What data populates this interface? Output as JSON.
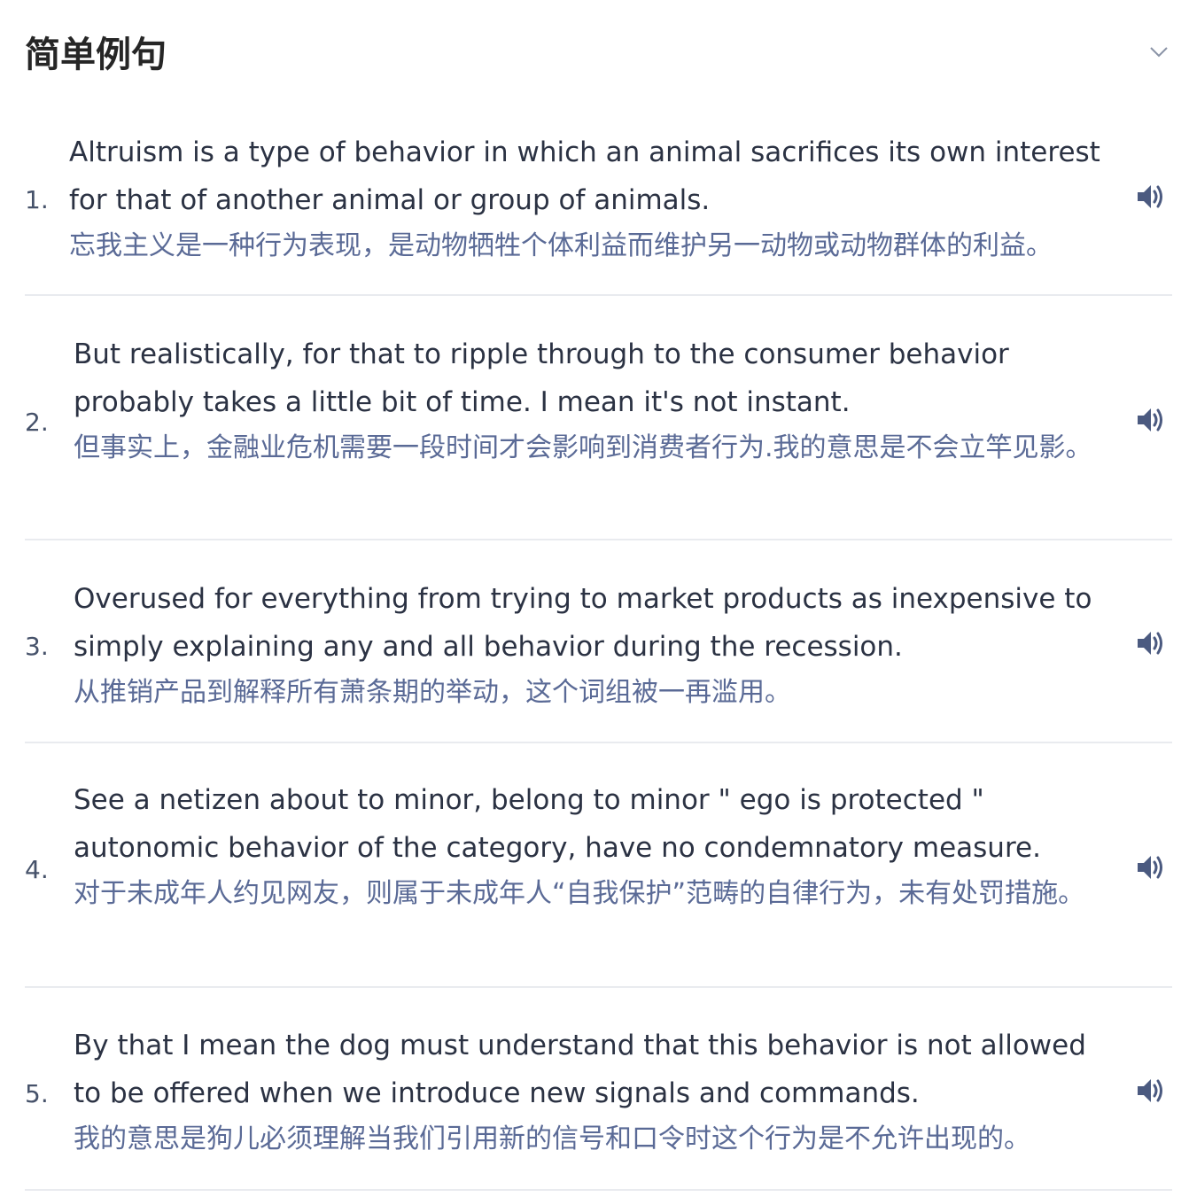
{
  "section": {
    "title": "简单例句",
    "toggle_icon": "chevron-down-icon"
  },
  "colors": {
    "english_text": "#2b3243",
    "translation_text": "#5a6a96",
    "icon": "#4b5a80",
    "divider": "#e9ebef"
  },
  "examples": [
    {
      "number": "1.",
      "english": [
        "Altruism is a type of behavior in which an animal sacrifices its own interest",
        "for that of another animal or group of animals."
      ],
      "translation": "忘我主义是一种行为表现，是动物牺牲个体利益而维护另一动物或动物群体的利益。",
      "audio_icon": "speaker-icon"
    },
    {
      "number": "2.",
      "english": [
        "But realistically, for that to ripple through to the consumer behavior",
        "probably takes a little bit of time. I mean it's not instant."
      ],
      "translation": "但事实上，金融业危机需要一段时间才会影响到消费者行为.我的意思是不会立竿见影。",
      "audio_icon": "speaker-icon"
    },
    {
      "number": "3.",
      "english": [
        "Overused for everything from trying to market products as inexpensive to",
        "simply explaining any and all behavior during the recession."
      ],
      "translation": "从推销产品到解释所有萧条期的举动，这个词组被一再滥用。",
      "audio_icon": "speaker-icon"
    },
    {
      "number": "4.",
      "english": [
        "See a netizen about to minor, belong to minor \" ego is protected \"",
        "autonomic behavior of the category, have no condemnatory measure."
      ],
      "translation": "对于未成年人约见网友，则属于未成年人“自我保护”范畴的自律行为，未有处罚措施。",
      "audio_icon": "speaker-icon"
    },
    {
      "number": "5.",
      "english": [
        "By that I mean the dog must understand that this behavior is not allowed",
        "to be offered when we introduce new signals and commands."
      ],
      "translation": "我的意思是狗儿必须理解当我们引用新的信号和口令时这个行为是不允许出现的。",
      "audio_icon": "speaker-icon"
    }
  ]
}
